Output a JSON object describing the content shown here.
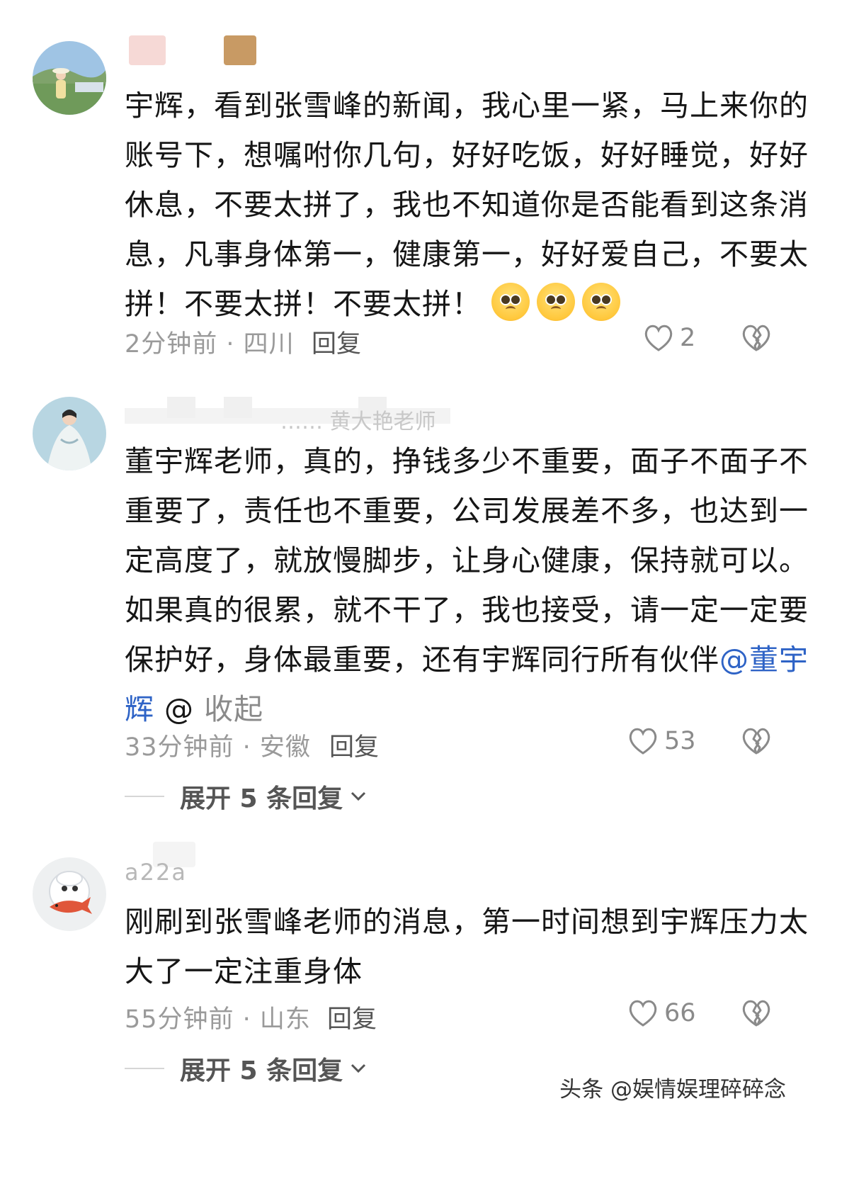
{
  "comments": [
    {
      "body": "宇辉，看到张雪峰的新闻，我心里一紧，马上来你的账号下，想嘱咐你几句，好好吃饭，好好睡觉，好好休息，不要太拼了，我也不知道你是否能看到这条消息，凡事身体第一，健康第一，好好爱自己，不要太拼！不要太拼！不要太拼！",
      "emoji_icons": [
        "pleading-face-icon",
        "pleading-face-icon",
        "pleading-face-icon"
      ],
      "meta": "2分钟前 · 四川",
      "reply_label": "回复",
      "likes": "2"
    },
    {
      "name": "…… 黄大艳老师",
      "body": "董宇辉老师，真的，挣钱多少不重要，面子不面子不重要了，责任也不重要，公司发展差不多，也达到一定高度了，就放慢脚步，让身心健康，保持就可以。如果真的很累，就不干了，我也接受，请一定一定要保护好，身体最重要，还有宇辉同行所有伙伴",
      "mention": "@董宇辉",
      "at_symbol": "@",
      "collapse_label": "收起",
      "meta": "33分钟前 · 安徽",
      "reply_label": "回复",
      "likes": "53",
      "expand_label": "展开 5 条回复"
    },
    {
      "name": "a22a",
      "body": "刚刷到张雪峰老师的消息，第一时间想到宇辉压力太大了一定注重身体",
      "meta": "55分钟前 · 山东",
      "reply_label": "回复",
      "likes": "66",
      "expand_label": "展开 5 条回复"
    }
  ],
  "watermark": "头条 @娱情娱理碎碎念",
  "colors": {
    "mention": "#2e63c6",
    "meta": "#9a9a9a",
    "text": "#161616"
  }
}
